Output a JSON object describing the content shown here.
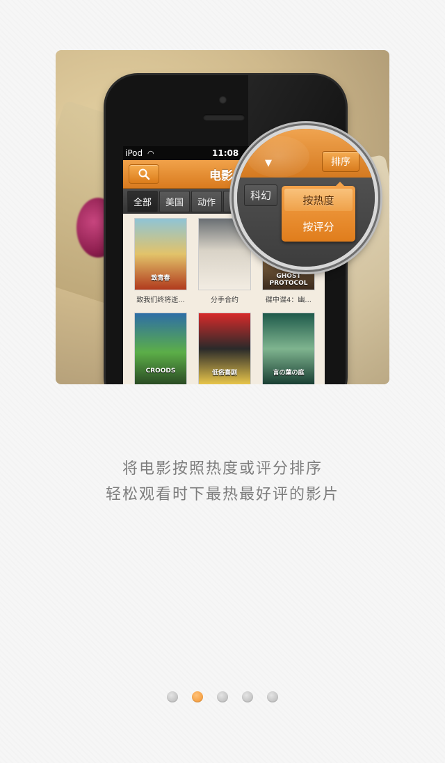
{
  "phone": {
    "status": {
      "carrier": "iPod",
      "time": "11:08"
    },
    "nav_title": "电影",
    "filters": [
      "全部",
      "美国",
      "动作",
      "科"
    ],
    "movies": [
      {
        "poster_text": "致青春",
        "caption": "致我们终将逝..."
      },
      {
        "poster_text": "",
        "caption": "分手合约"
      },
      {
        "poster_text": "GHOST PROTOCOL",
        "caption": "碟中谍4：幽..."
      },
      {
        "poster_text": "CROODS",
        "caption": ""
      },
      {
        "poster_text": "低俗喜剧",
        "caption": ""
      },
      {
        "poster_text": "言の葉の庭",
        "caption": ""
      }
    ]
  },
  "magnifier": {
    "filter_label": "科幻",
    "sort_button": "排序",
    "sort_options": [
      "按热度",
      "按评分"
    ]
  },
  "description": {
    "line1": "将电影按照热度或评分排序",
    "line2": "轻松观看时下最热最好评的影片"
  },
  "pager": {
    "total": 5,
    "active_index": 1
  },
  "colors": {
    "accent": "#f0912b",
    "text": "#7d7d7d"
  }
}
